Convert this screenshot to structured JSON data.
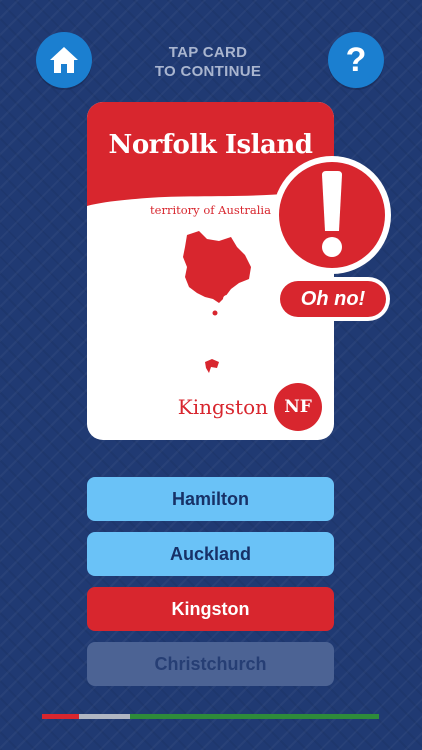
{
  "header": {
    "hint_line1": "TAP CARD",
    "hint_line2": "TO CONTINUE",
    "home_icon": "home-icon",
    "help_label": "?"
  },
  "card": {
    "title": "Norfolk Island",
    "subtitle": "territory of Australia",
    "capital": "Kingston",
    "code": "NF",
    "map_icon": "island-map-icon"
  },
  "feedback": {
    "icon": "exclamation-icon",
    "label": "Oh no!"
  },
  "answers": [
    {
      "label": "Hamilton",
      "state": "option"
    },
    {
      "label": "Auckland",
      "state": "option"
    },
    {
      "label": "Kingston",
      "state": "selected-correct"
    },
    {
      "label": "Christchurch",
      "state": "disabled"
    }
  ],
  "progress": {
    "segments": [
      {
        "status": "wrong",
        "fraction": 0.11,
        "color": "#d8262e"
      },
      {
        "status": "pending",
        "fraction": 0.15,
        "color": "#b0b6c2"
      },
      {
        "status": "correct",
        "fraction": 0.74,
        "color": "#2e8b3a"
      }
    ]
  },
  "colors": {
    "background": "#203a73",
    "accent_red": "#d8262e",
    "button_blue": "#1b7fd0",
    "answer_blue": "#6ac2f7"
  }
}
